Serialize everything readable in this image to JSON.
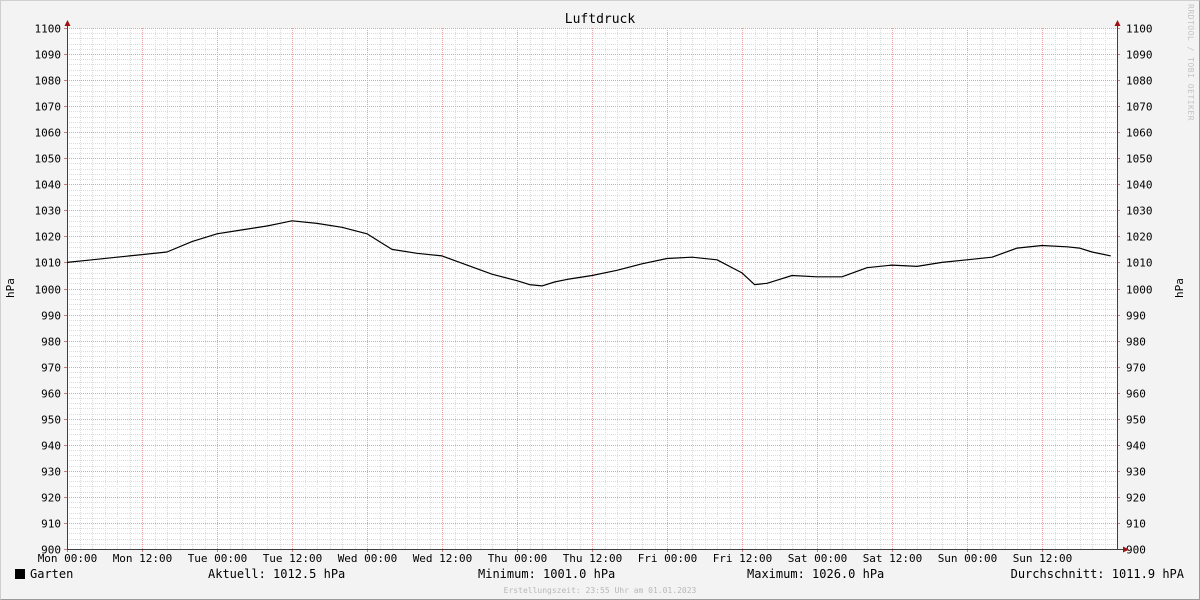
{
  "chart_data": {
    "type": "line",
    "title": "Luftdruck",
    "ylabel": "hPa",
    "ylabel_right": "hPa",
    "ylim": [
      900,
      1100
    ],
    "y_ticks": [
      900,
      910,
      920,
      930,
      940,
      950,
      960,
      970,
      980,
      990,
      1000,
      1010,
      1020,
      1030,
      1040,
      1050,
      1060,
      1070,
      1080,
      1090,
      1100
    ],
    "x_ticks": [
      "Mon 00:00",
      "Mon 12:00",
      "Tue 00:00",
      "Tue 12:00",
      "Wed 00:00",
      "Wed 12:00",
      "Thu 00:00",
      "Thu 12:00",
      "Fri 00:00",
      "Fri 12:00",
      "Sat 00:00",
      "Sat 12:00",
      "Sun 00:00",
      "Sun 12:00"
    ],
    "x_unit": "hours since Mon 00:00",
    "xlim": [
      0,
      168
    ],
    "grid": true,
    "series": [
      {
        "name": "Garten",
        "color": "#000000",
        "x": [
          0,
          4,
          8,
          12,
          16,
          20,
          24,
          28,
          32,
          34,
          36,
          40,
          44,
          48,
          50,
          52,
          56,
          60,
          64,
          68,
          72,
          74,
          76,
          78,
          80,
          84,
          88,
          92,
          96,
          100,
          104,
          108,
          110,
          112,
          114,
          116,
          120,
          124,
          128,
          132,
          136,
          140,
          144,
          148,
          152,
          156,
          160,
          162,
          164,
          167
        ],
        "values": [
          1010,
          1011,
          1012,
          1013,
          1014,
          1018,
          1021,
          1022.5,
          1024,
          1025,
          1026,
          1025,
          1023.5,
          1021,
          1018,
          1015,
          1013.5,
          1012.5,
          1009,
          1005.5,
          1003,
          1001.5,
          1001,
          1002.5,
          1003.5,
          1005,
          1007,
          1009.5,
          1011.5,
          1012,
          1011,
          1006,
          1001.5,
          1002,
          1003.5,
          1005,
          1004.5,
          1004.5,
          1008,
          1009,
          1008.5,
          1010,
          1011,
          1012,
          1015.5,
          1016.5,
          1016,
          1015.5,
          1014,
          1012.5
        ]
      }
    ],
    "legend": {
      "series_label": "Garten",
      "aktuell": "Aktuell: 1012.5 hPa",
      "minimum": "Minimum: 1001.0 hPa",
      "maximum": "Maximum: 1026.0 hPa",
      "durchschnitt": "Durchschnitt: 1011.9 hPA"
    },
    "footer": "Erstellungszeit: 23:55 Uhr am 01.01.2023",
    "watermark": "RRDTOOL / TOBI OETIKER",
    "colors": {
      "background": "#f3f3f3",
      "plot_background": "#ffffff",
      "minor_grid": "#dcdcdc",
      "major_grid": "#e8a0a0",
      "axis_arrow": "#a01010"
    }
  }
}
